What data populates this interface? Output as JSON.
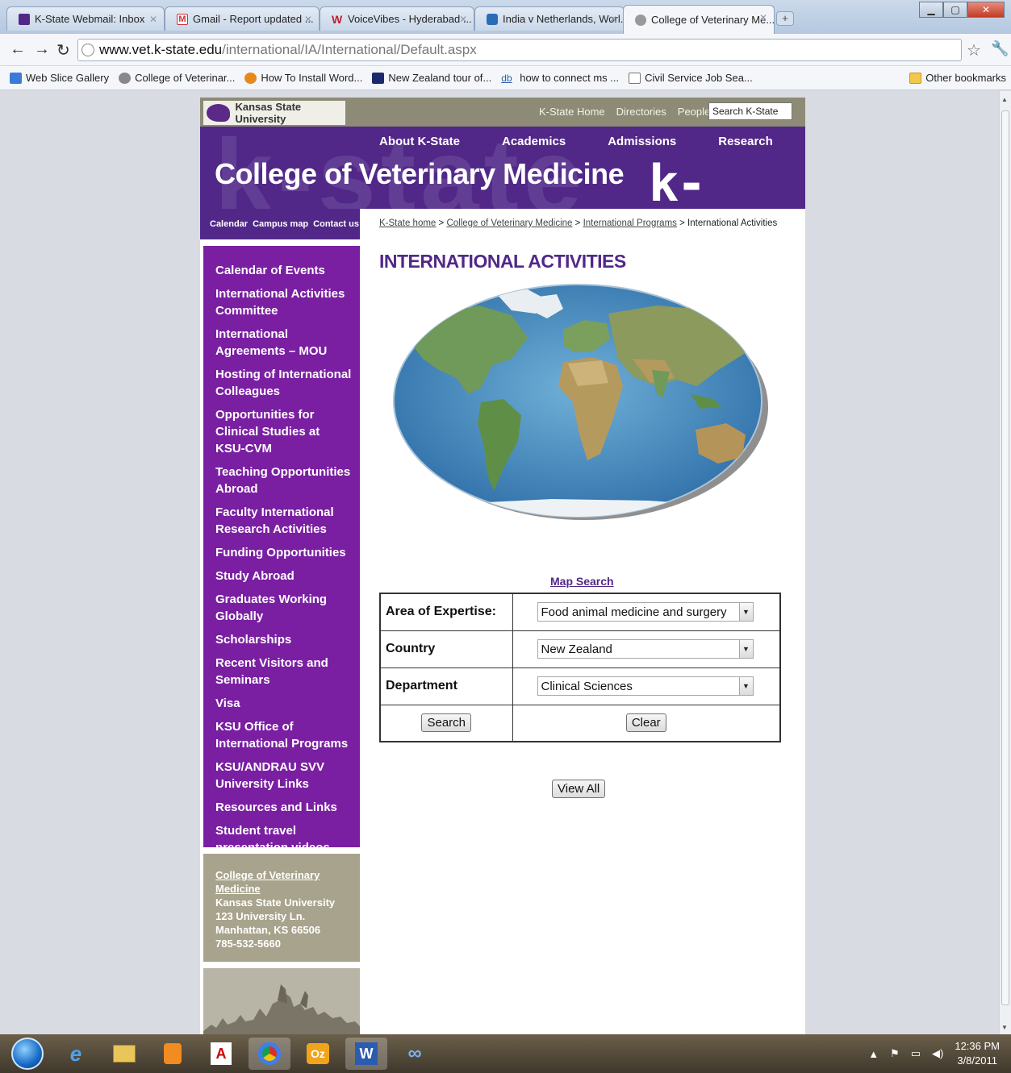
{
  "browser": {
    "tabs": [
      {
        "label": "K-State Webmail: Inbox",
        "active": false
      },
      {
        "label": "Gmail - Report updated ...",
        "active": false
      },
      {
        "label": "VoiceVibes - Hyderabad ...",
        "active": false
      },
      {
        "label": "India v Netherlands, Worl...",
        "active": false
      },
      {
        "label": "College of Veterinary Me...",
        "active": true
      }
    ],
    "url_host": "www.vet.k-state.edu",
    "url_path": "/international/IA/International/Default.aspx",
    "bookmarks": [
      "Web Slice Gallery",
      "College of Veterinar...",
      "How To Install Word...",
      "New Zealand tour of...",
      "how to connect ms ...",
      "Civil Service Job Sea..."
    ],
    "other_bookmarks": "Other bookmarks"
  },
  "site": {
    "logo_text": "Kansas State University",
    "top_links": [
      "K-State Home",
      "Directories",
      "People"
    ],
    "search_placeholder": "Search K-State",
    "main_nav": [
      "About K-State",
      "Academics",
      "Admissions",
      "Research"
    ],
    "college_title": "College of Veterinary Medicine",
    "kstate_wordmark": "k-state",
    "util_links": [
      "Calendar",
      "Campus map",
      "Contact us"
    ],
    "breadcrumb": {
      "links": [
        "K-State home",
        "College of Veterinary Medicine",
        "International Programs"
      ],
      "current": "International Activities",
      "separator": ">"
    }
  },
  "sidebar": {
    "items": [
      "Calendar of Events",
      "International Activities Committee",
      "International Agreements – MOU",
      "Hosting of International Colleagues",
      "Opportunities for Clinical Studies at KSU-CVM",
      "Teaching Opportunities Abroad",
      "Faculty International Research Activities",
      "Funding Opportunities",
      "Study Abroad",
      "Graduates Working Globally",
      "Scholarships",
      "Recent Visitors and Seminars",
      "Visa",
      "KSU Office of International Programs",
      "KSU/ANDRAU SVV University Links",
      "Resources and Links",
      "Student travel presentation videos"
    ],
    "address": {
      "link": "College of Veterinary Medicine",
      "lines": [
        "Kansas State University",
        "123 University Ln.",
        "Manhattan, KS 66506",
        "785-532-5660"
      ]
    }
  },
  "main": {
    "title": "INTERNATIONAL ACTIVITIES",
    "map_search_link": "Map Search",
    "form": {
      "expertise_label": "Area of Expertise:",
      "expertise_value": "Food animal medicine and surgery",
      "country_label": "Country",
      "country_value": "New Zealand",
      "department_label": "Department",
      "department_value": "Clinical Sciences",
      "search_button": "Search",
      "clear_button": "Clear"
    },
    "view_all_button": "View All"
  },
  "taskbar": {
    "time": "12:36 PM",
    "date": "3/8/2011"
  },
  "colors": {
    "ksu_purple": "#512888",
    "sidebar_purple": "#7a1fa2",
    "address_tan": "#a8a38c"
  }
}
